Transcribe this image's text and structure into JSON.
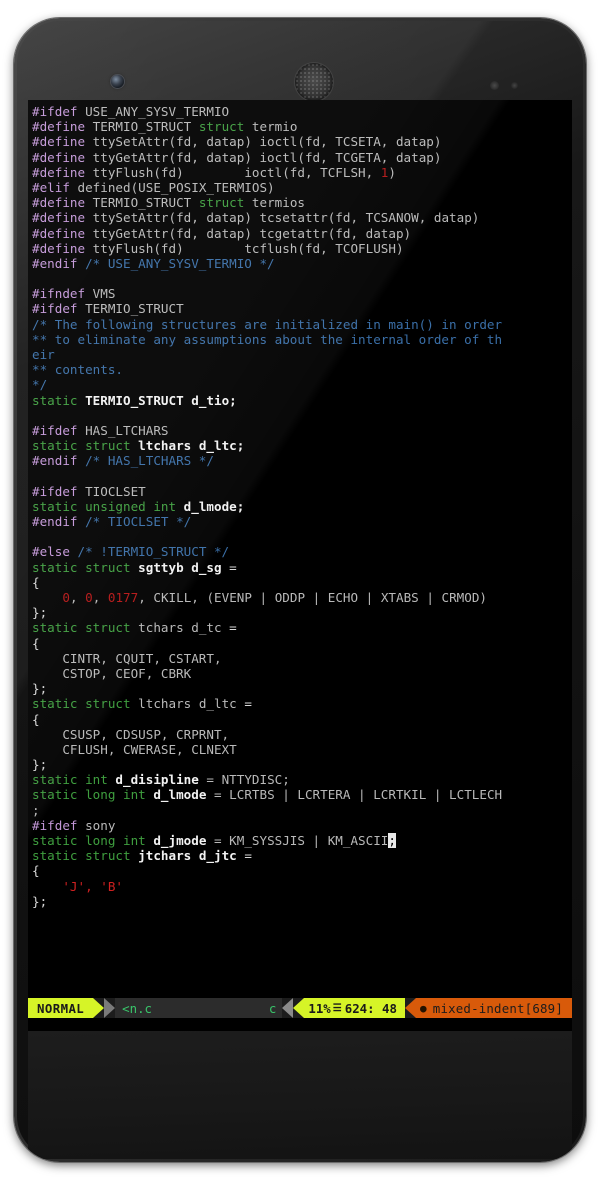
{
  "device": {
    "name": "nexus-phone",
    "front_camera": "camera-icon",
    "earpiece": "speaker-grille-icon",
    "proximity_sensor": "proximity-sensor-icon",
    "light_sensor": "light-sensor-icon"
  },
  "editor": {
    "app": "vim",
    "mode": "NORMAL",
    "filename": "<n.c",
    "filetype": "c",
    "percent": "11%",
    "line_icon": "line-number-icon",
    "position": "624: 48",
    "warning_icon": "warning-icon",
    "warning": "mixed-indent[689]",
    "cursor": {
      "line": 624,
      "col": 48,
      "char": ";"
    },
    "colors": {
      "background": "#000000",
      "preprocessor": "#c397d8",
      "keyword": "#3f9f3f",
      "identifier": "#b9b9b9",
      "identifier_bold": "#f2f2f2",
      "comment": "#3a6fa8",
      "number": "#b51414",
      "string": "#d02020",
      "mode_bg": "#d6f427",
      "warn_bg": "#d85a0a",
      "status_bg": "#2c2c2c",
      "status_fg": "#39c46a"
    },
    "lines": [
      [
        {
          "t": "#ifdef ",
          "c": "pre"
        },
        {
          "t": "USE_ANY_SYSV_TERMIO",
          "c": "id"
        }
      ],
      [
        {
          "t": "#define ",
          "c": "pre"
        },
        {
          "t": "TERMIO_STRUCT ",
          "c": "id"
        },
        {
          "t": "struct",
          "c": "kw"
        },
        {
          "t": " termio",
          "c": "id"
        }
      ],
      [
        {
          "t": "#define ",
          "c": "pre"
        },
        {
          "t": "ttySetAttr(fd, datap) ioctl(fd, TCSETA, datap)",
          "c": "id"
        }
      ],
      [
        {
          "t": "#define ",
          "c": "pre"
        },
        {
          "t": "ttyGetAttr(fd, datap) ioctl(fd, TCGETA, datap)",
          "c": "id"
        }
      ],
      [
        {
          "t": "#define ",
          "c": "pre"
        },
        {
          "t": "ttyFlush(fd)        ioctl(fd, TCFLSH, ",
          "c": "id"
        },
        {
          "t": "1",
          "c": "num"
        },
        {
          "t": ")",
          "c": "id"
        }
      ],
      [
        {
          "t": "#elif ",
          "c": "pre"
        },
        {
          "t": "defined(USE_POSIX_TERMIOS)",
          "c": "id"
        }
      ],
      [
        {
          "t": "#define ",
          "c": "pre"
        },
        {
          "t": "TERMIO_STRUCT ",
          "c": "id"
        },
        {
          "t": "struct",
          "c": "kw"
        },
        {
          "t": " termios",
          "c": "id"
        }
      ],
      [
        {
          "t": "#define ",
          "c": "pre"
        },
        {
          "t": "ttySetAttr(fd, datap) tcsetattr(fd, TCSANOW, datap)",
          "c": "id"
        }
      ],
      [
        {
          "t": "#define ",
          "c": "pre"
        },
        {
          "t": "ttyGetAttr(fd, datap) tcgetattr(fd, datap)",
          "c": "id"
        }
      ],
      [
        {
          "t": "#define ",
          "c": "pre"
        },
        {
          "t": "ttyFlush(fd)        tcflush(fd, TCOFLUSH)",
          "c": "id"
        }
      ],
      [
        {
          "t": "#endif ",
          "c": "pre"
        },
        {
          "t": "/* USE_ANY_SYSV_TERMIO */",
          "c": "cmt"
        }
      ],
      [],
      [
        {
          "t": "#ifndef ",
          "c": "pre"
        },
        {
          "t": "VMS",
          "c": "id"
        }
      ],
      [
        {
          "t": "#ifdef ",
          "c": "pre"
        },
        {
          "t": "TERMIO_STRUCT",
          "c": "id"
        }
      ],
      [
        {
          "t": "/* The following structures are initialized in main() in order",
          "c": "cmt"
        }
      ],
      [
        {
          "t": "** to eliminate any assumptions about the internal order of th",
          "c": "cmt"
        }
      ],
      [
        {
          "t": "eir",
          "c": "cmt"
        }
      ],
      [
        {
          "t": "** contents.",
          "c": "cmt"
        }
      ],
      [
        {
          "t": "*/",
          "c": "cmt"
        }
      ],
      [
        {
          "t": "static",
          "c": "kw"
        },
        {
          "t": " ",
          "c": "id"
        },
        {
          "t": "TERMIO_STRUCT d_tio;",
          "c": "idb"
        }
      ],
      [],
      [
        {
          "t": "#ifdef ",
          "c": "pre"
        },
        {
          "t": "HAS_LTCHARS",
          "c": "id"
        }
      ],
      [
        {
          "t": "static struct",
          "c": "kw"
        },
        {
          "t": " ",
          "c": "id"
        },
        {
          "t": "ltchars d_ltc;",
          "c": "idb"
        }
      ],
      [
        {
          "t": "#endif ",
          "c": "pre"
        },
        {
          "t": "/* HAS_LTCHARS */",
          "c": "cmt"
        }
      ],
      [],
      [
        {
          "t": "#ifdef ",
          "c": "pre"
        },
        {
          "t": "TIOCLSET",
          "c": "id"
        }
      ],
      [
        {
          "t": "static unsigned int",
          "c": "kw"
        },
        {
          "t": " ",
          "c": "id"
        },
        {
          "t": "d_lmode;",
          "c": "idb"
        }
      ],
      [
        {
          "t": "#endif ",
          "c": "pre"
        },
        {
          "t": "/* TIOCLSET */",
          "c": "cmt"
        }
      ],
      [],
      [
        {
          "t": "#else ",
          "c": "pre"
        },
        {
          "t": "/* !TERMIO_STRUCT */",
          "c": "cmt"
        }
      ],
      [
        {
          "t": "static struct",
          "c": "kw"
        },
        {
          "t": " ",
          "c": "id"
        },
        {
          "t": "sgttyb d_sg",
          "c": "idb"
        },
        {
          "t": " =",
          "c": "punc"
        }
      ],
      [
        {
          "t": "{",
          "c": "punc"
        }
      ],
      [
        {
          "t": "    ",
          "c": "id"
        },
        {
          "t": "0",
          "c": "num"
        },
        {
          "t": ", ",
          "c": "id"
        },
        {
          "t": "0",
          "c": "num"
        },
        {
          "t": ", ",
          "c": "id"
        },
        {
          "t": "0177",
          "c": "num"
        },
        {
          "t": ", CKILL, (EVENP | ODDP | ECHO | XTABS | CRMOD)",
          "c": "id"
        }
      ],
      [
        {
          "t": "};",
          "c": "punc"
        }
      ],
      [
        {
          "t": "static struct",
          "c": "kw"
        },
        {
          "t": " ",
          "c": "id"
        },
        {
          "t": "tchars d_tc",
          "c": "id"
        },
        {
          "t": " =",
          "c": "punc"
        }
      ],
      [
        {
          "t": "{",
          "c": "punc"
        }
      ],
      [
        {
          "t": "    CINTR, CQUIT, CSTART,",
          "c": "id"
        }
      ],
      [
        {
          "t": "    CSTOP, CEOF, CBRK",
          "c": "id"
        }
      ],
      [
        {
          "t": "};",
          "c": "punc"
        }
      ],
      [
        {
          "t": "static struct",
          "c": "kw"
        },
        {
          "t": " ",
          "c": "id"
        },
        {
          "t": "ltchars d_ltc",
          "c": "id"
        },
        {
          "t": " =",
          "c": "punc"
        }
      ],
      [
        {
          "t": "{",
          "c": "punc"
        }
      ],
      [
        {
          "t": "    CSUSP, CDSUSP, CRPRNT,",
          "c": "id"
        }
      ],
      [
        {
          "t": "    CFLUSH, CWERASE, CLNEXT",
          "c": "id"
        }
      ],
      [
        {
          "t": "};",
          "c": "punc"
        }
      ],
      [
        {
          "t": "static int",
          "c": "kw"
        },
        {
          "t": " ",
          "c": "id"
        },
        {
          "t": "d_disipline",
          "c": "idb"
        },
        {
          "t": " = NTTYDISC;",
          "c": "id"
        }
      ],
      [
        {
          "t": "static long int",
          "c": "kw"
        },
        {
          "t": " ",
          "c": "id"
        },
        {
          "t": "d_lmode",
          "c": "idb"
        },
        {
          "t": " = LCRTBS | LCRTERA | LCRTKIL | LCTLECH",
          "c": "id"
        }
      ],
      [
        {
          "t": ";",
          "c": "id"
        }
      ],
      [
        {
          "t": "#ifdef ",
          "c": "pre"
        },
        {
          "t": "sony",
          "c": "id"
        }
      ],
      [
        {
          "t": "static long int",
          "c": "kw"
        },
        {
          "t": " ",
          "c": "id"
        },
        {
          "t": "d_jmode",
          "c": "idb"
        },
        {
          "t": " = KM_SYSSJIS | KM_ASCII",
          "c": "id"
        },
        {
          "t": ";",
          "c": "cursor"
        }
      ],
      [
        {
          "t": "static struct",
          "c": "kw"
        },
        {
          "t": " ",
          "c": "id"
        },
        {
          "t": "jtchars d_jtc",
          "c": "idb"
        },
        {
          "t": " =",
          "c": "punc"
        }
      ],
      [
        {
          "t": "{",
          "c": "punc"
        }
      ],
      [
        {
          "t": "    ",
          "c": "id"
        },
        {
          "t": "'J', 'B'",
          "c": "str"
        }
      ],
      [
        {
          "t": "};",
          "c": "punc"
        }
      ]
    ]
  }
}
